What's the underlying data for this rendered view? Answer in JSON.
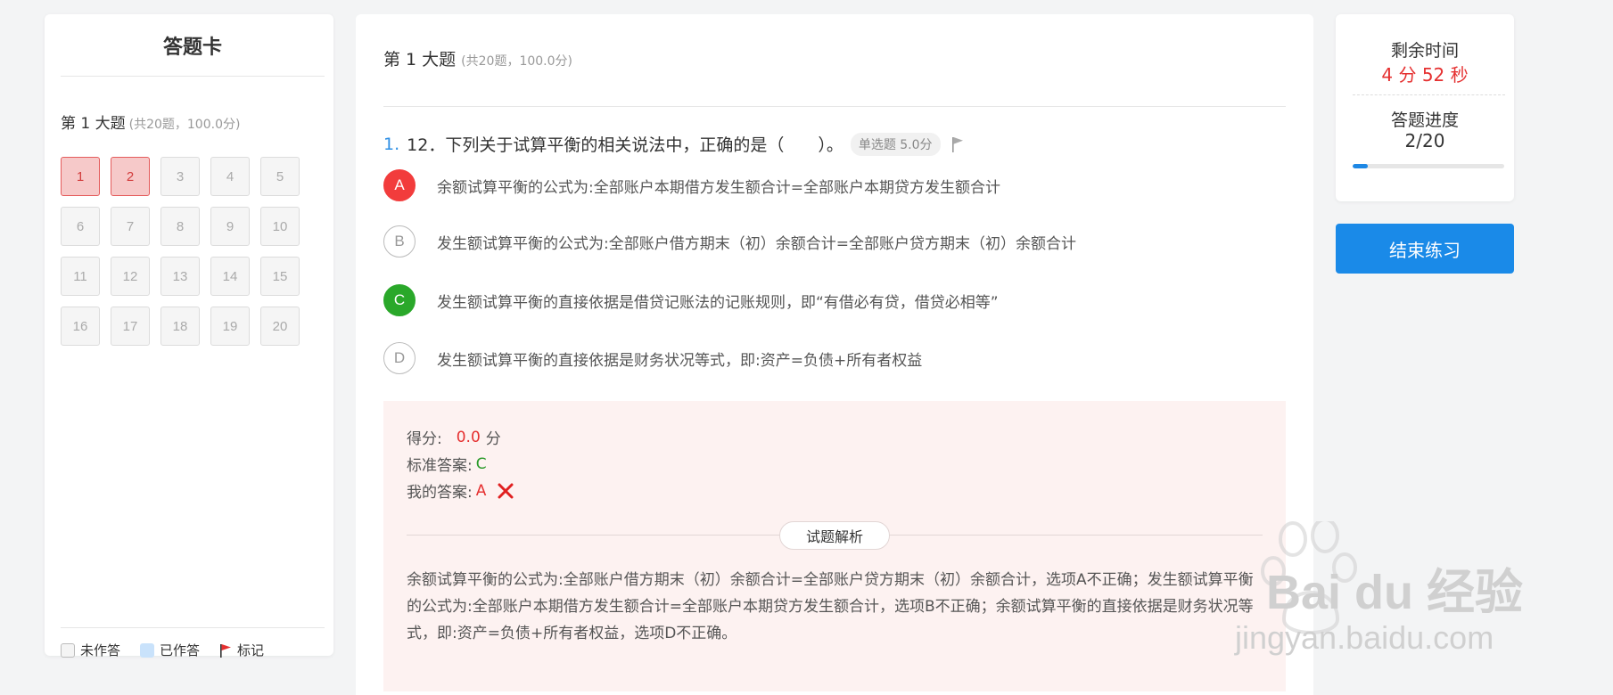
{
  "answer_card": {
    "title": "答题卡",
    "section_title": "第 1 大题",
    "section_sub": "(共20题，100.0分)",
    "questions": [
      {
        "n": "1",
        "state": "done"
      },
      {
        "n": "2",
        "state": "done"
      },
      {
        "n": "3",
        "state": "todo"
      },
      {
        "n": "4",
        "state": "todo"
      },
      {
        "n": "5",
        "state": "todo"
      },
      {
        "n": "6",
        "state": "todo"
      },
      {
        "n": "7",
        "state": "todo"
      },
      {
        "n": "8",
        "state": "todo"
      },
      {
        "n": "9",
        "state": "todo"
      },
      {
        "n": "10",
        "state": "todo"
      },
      {
        "n": "11",
        "state": "todo"
      },
      {
        "n": "12",
        "state": "todo"
      },
      {
        "n": "13",
        "state": "todo"
      },
      {
        "n": "14",
        "state": "todo"
      },
      {
        "n": "15",
        "state": "todo"
      },
      {
        "n": "16",
        "state": "todo"
      },
      {
        "n": "17",
        "state": "todo"
      },
      {
        "n": "18",
        "state": "todo"
      },
      {
        "n": "19",
        "state": "todo"
      },
      {
        "n": "20",
        "state": "todo"
      }
    ],
    "legend": {
      "unanswered": "未作答",
      "answered": "已作答",
      "flagged": "标记"
    }
  },
  "main": {
    "section_title": "第 1 大题",
    "section_sub": "(共20题，100.0分)",
    "question": {
      "number": "1.",
      "text": "12．下列关于试算平衡的相关说法中，正确的是（　　）。",
      "tag": "单选题 5.0分"
    },
    "options": [
      {
        "letter": "A",
        "state": "wrong",
        "text": "余额试算平衡的公式为:全部账户本期借方发生额合计=全部账户本期贷方发生额合计"
      },
      {
        "letter": "B",
        "state": "normal",
        "text": "发生额试算平衡的公式为:全部账户借方期末（初）余额合计=全部账户贷方期末（初）余额合计"
      },
      {
        "letter": "C",
        "state": "right",
        "text": "发生额试算平衡的直接依据是借贷记账法的记账规则，即“有借必有贷，借贷必相等”"
      },
      {
        "letter": "D",
        "state": "normal",
        "text": "发生额试算平衡的直接依据是财务状况等式，即:资产=负债+所有者权益"
      }
    ],
    "result": {
      "score_label": "得分:",
      "score_value": "0.0",
      "score_unit": "分",
      "std_label": "标准答案:",
      "std_value": "C",
      "my_label": "我的答案:",
      "my_value": "A",
      "analysis_title": "试题解析",
      "analysis_text": "余额试算平衡的公式为:全部账户借方期末（初）余额合计=全部账户贷方期末（初）余额合计，选项A不正确；发生额试算平衡的公式为:全部账户本期借方发生额合计=全部账户本期贷方发生额合计，选项B不正确；余额试算平衡的直接依据是财务状况等式，即:资产=负债+所有者权益，选项D不正确。"
    }
  },
  "sidebar_right": {
    "time_label": "剩余时间",
    "time_value": "4 分 52 秒",
    "progress_label": "答题进度",
    "progress_value": "2/20",
    "progress_fraction": 0.1,
    "end_button": "结束练习"
  },
  "watermark": {
    "brand": "Bai du 经验",
    "url": "jingyan.baidu.com"
  },
  "colors": {
    "accent": "#1a8ae8",
    "wrong": "#f23c3c",
    "right": "#2aa82a",
    "answered_box": "#f6c9c9"
  }
}
